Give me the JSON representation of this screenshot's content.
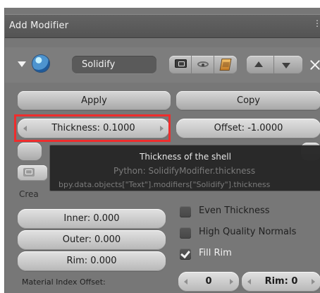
{
  "header": {
    "title": "Add Modifier",
    "drag_handle": "drag-handle-icon"
  },
  "modifier": {
    "name": "Solidify",
    "icons": {
      "toggle": "triangle-down-icon",
      "type": "solidify-icon",
      "render": "render-icon",
      "view": "eye-icon",
      "cage": "cage-icon",
      "move_up": "arrow-up-icon",
      "move_down": "arrow-down-icon",
      "remove": "close-icon"
    }
  },
  "actions": {
    "apply_label": "Apply",
    "copy_label": "Copy"
  },
  "fields": {
    "thickness": "Thickness: 0.1000",
    "offset": "Offset: -1.0000",
    "inner": "Inner: 0.000",
    "outer": "Outer: 0.000",
    "rim": "Rim: 0.000"
  },
  "tooltip": {
    "title": "Thickness of the shell",
    "python": "Python: SolidifyModifier.thickness",
    "path": "bpy.data.objects[\"Text\"].modifiers[\"Solidify\"].thickness"
  },
  "section": {
    "create_label": "Crea"
  },
  "options": {
    "even_thickness": "Even Thickness",
    "high_quality_normals": "High Quality Normals",
    "fill_rim": "Fill Rim"
  },
  "material": {
    "label": "Material Index Offset:",
    "value": "0",
    "rim": "Rim: 0"
  },
  "colors": {
    "highlight": "#ef2d2d",
    "panel": "#777777",
    "tooltip_background": "#252525",
    "tooltip_text": "#e7e7e7"
  }
}
